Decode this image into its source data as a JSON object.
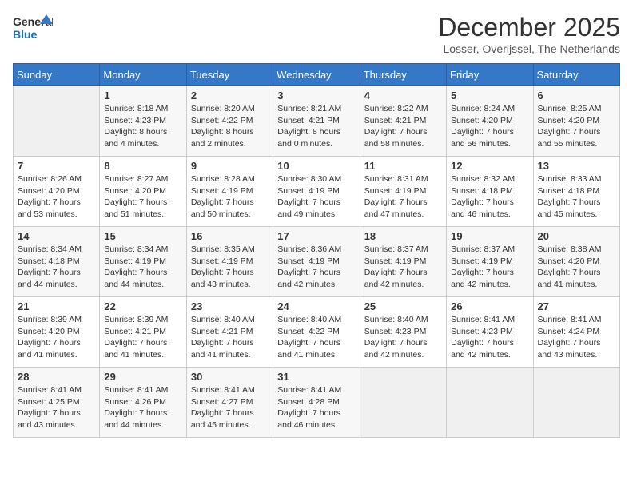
{
  "header": {
    "logo_line1": "General",
    "logo_line2": "Blue",
    "month": "December 2025",
    "location": "Losser, Overijssel, The Netherlands"
  },
  "days_of_week": [
    "Sunday",
    "Monday",
    "Tuesday",
    "Wednesday",
    "Thursday",
    "Friday",
    "Saturday"
  ],
  "weeks": [
    [
      {
        "day": "",
        "sunrise": "",
        "sunset": "",
        "daylight": ""
      },
      {
        "day": "1",
        "sunrise": "Sunrise: 8:18 AM",
        "sunset": "Sunset: 4:23 PM",
        "daylight": "Daylight: 8 hours and 4 minutes."
      },
      {
        "day": "2",
        "sunrise": "Sunrise: 8:20 AM",
        "sunset": "Sunset: 4:22 PM",
        "daylight": "Daylight: 8 hours and 2 minutes."
      },
      {
        "day": "3",
        "sunrise": "Sunrise: 8:21 AM",
        "sunset": "Sunset: 4:21 PM",
        "daylight": "Daylight: 8 hours and 0 minutes."
      },
      {
        "day": "4",
        "sunrise": "Sunrise: 8:22 AM",
        "sunset": "Sunset: 4:21 PM",
        "daylight": "Daylight: 7 hours and 58 minutes."
      },
      {
        "day": "5",
        "sunrise": "Sunrise: 8:24 AM",
        "sunset": "Sunset: 4:20 PM",
        "daylight": "Daylight: 7 hours and 56 minutes."
      },
      {
        "day": "6",
        "sunrise": "Sunrise: 8:25 AM",
        "sunset": "Sunset: 4:20 PM",
        "daylight": "Daylight: 7 hours and 55 minutes."
      }
    ],
    [
      {
        "day": "7",
        "sunrise": "Sunrise: 8:26 AM",
        "sunset": "Sunset: 4:20 PM",
        "daylight": "Daylight: 7 hours and 53 minutes."
      },
      {
        "day": "8",
        "sunrise": "Sunrise: 8:27 AM",
        "sunset": "Sunset: 4:20 PM",
        "daylight": "Daylight: 7 hours and 51 minutes."
      },
      {
        "day": "9",
        "sunrise": "Sunrise: 8:28 AM",
        "sunset": "Sunset: 4:19 PM",
        "daylight": "Daylight: 7 hours and 50 minutes."
      },
      {
        "day": "10",
        "sunrise": "Sunrise: 8:30 AM",
        "sunset": "Sunset: 4:19 PM",
        "daylight": "Daylight: 7 hours and 49 minutes."
      },
      {
        "day": "11",
        "sunrise": "Sunrise: 8:31 AM",
        "sunset": "Sunset: 4:19 PM",
        "daylight": "Daylight: 7 hours and 47 minutes."
      },
      {
        "day": "12",
        "sunrise": "Sunrise: 8:32 AM",
        "sunset": "Sunset: 4:18 PM",
        "daylight": "Daylight: 7 hours and 46 minutes."
      },
      {
        "day": "13",
        "sunrise": "Sunrise: 8:33 AM",
        "sunset": "Sunset: 4:18 PM",
        "daylight": "Daylight: 7 hours and 45 minutes."
      }
    ],
    [
      {
        "day": "14",
        "sunrise": "Sunrise: 8:34 AM",
        "sunset": "Sunset: 4:18 PM",
        "daylight": "Daylight: 7 hours and 44 minutes."
      },
      {
        "day": "15",
        "sunrise": "Sunrise: 8:34 AM",
        "sunset": "Sunset: 4:19 PM",
        "daylight": "Daylight: 7 hours and 44 minutes."
      },
      {
        "day": "16",
        "sunrise": "Sunrise: 8:35 AM",
        "sunset": "Sunset: 4:19 PM",
        "daylight": "Daylight: 7 hours and 43 minutes."
      },
      {
        "day": "17",
        "sunrise": "Sunrise: 8:36 AM",
        "sunset": "Sunset: 4:19 PM",
        "daylight": "Daylight: 7 hours and 42 minutes."
      },
      {
        "day": "18",
        "sunrise": "Sunrise: 8:37 AM",
        "sunset": "Sunset: 4:19 PM",
        "daylight": "Daylight: 7 hours and 42 minutes."
      },
      {
        "day": "19",
        "sunrise": "Sunrise: 8:37 AM",
        "sunset": "Sunset: 4:19 PM",
        "daylight": "Daylight: 7 hours and 42 minutes."
      },
      {
        "day": "20",
        "sunrise": "Sunrise: 8:38 AM",
        "sunset": "Sunset: 4:20 PM",
        "daylight": "Daylight: 7 hours and 41 minutes."
      }
    ],
    [
      {
        "day": "21",
        "sunrise": "Sunrise: 8:39 AM",
        "sunset": "Sunset: 4:20 PM",
        "daylight": "Daylight: 7 hours and 41 minutes."
      },
      {
        "day": "22",
        "sunrise": "Sunrise: 8:39 AM",
        "sunset": "Sunset: 4:21 PM",
        "daylight": "Daylight: 7 hours and 41 minutes."
      },
      {
        "day": "23",
        "sunrise": "Sunrise: 8:40 AM",
        "sunset": "Sunset: 4:21 PM",
        "daylight": "Daylight: 7 hours and 41 minutes."
      },
      {
        "day": "24",
        "sunrise": "Sunrise: 8:40 AM",
        "sunset": "Sunset: 4:22 PM",
        "daylight": "Daylight: 7 hours and 41 minutes."
      },
      {
        "day": "25",
        "sunrise": "Sunrise: 8:40 AM",
        "sunset": "Sunset: 4:23 PM",
        "daylight": "Daylight: 7 hours and 42 minutes."
      },
      {
        "day": "26",
        "sunrise": "Sunrise: 8:41 AM",
        "sunset": "Sunset: 4:23 PM",
        "daylight": "Daylight: 7 hours and 42 minutes."
      },
      {
        "day": "27",
        "sunrise": "Sunrise: 8:41 AM",
        "sunset": "Sunset: 4:24 PM",
        "daylight": "Daylight: 7 hours and 43 minutes."
      }
    ],
    [
      {
        "day": "28",
        "sunrise": "Sunrise: 8:41 AM",
        "sunset": "Sunset: 4:25 PM",
        "daylight": "Daylight: 7 hours and 43 minutes."
      },
      {
        "day": "29",
        "sunrise": "Sunrise: 8:41 AM",
        "sunset": "Sunset: 4:26 PM",
        "daylight": "Daylight: 7 hours and 44 minutes."
      },
      {
        "day": "30",
        "sunrise": "Sunrise: 8:41 AM",
        "sunset": "Sunset: 4:27 PM",
        "daylight": "Daylight: 7 hours and 45 minutes."
      },
      {
        "day": "31",
        "sunrise": "Sunrise: 8:41 AM",
        "sunset": "Sunset: 4:28 PM",
        "daylight": "Daylight: 7 hours and 46 minutes."
      },
      {
        "day": "",
        "sunrise": "",
        "sunset": "",
        "daylight": ""
      },
      {
        "day": "",
        "sunrise": "",
        "sunset": "",
        "daylight": ""
      },
      {
        "day": "",
        "sunrise": "",
        "sunset": "",
        "daylight": ""
      }
    ]
  ]
}
